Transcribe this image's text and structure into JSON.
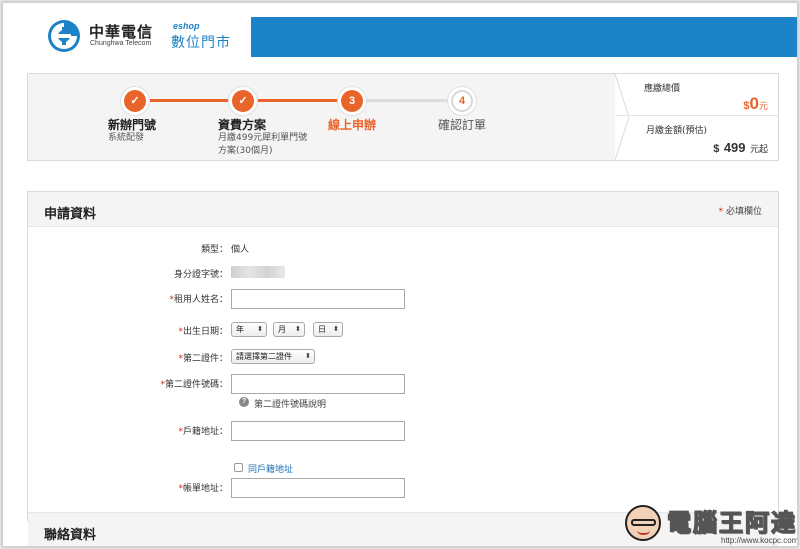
{
  "header": {
    "brand_cn": "中華電信",
    "brand_en": "Chunghwa Telecom",
    "eshop_tag": "eshop",
    "eshop_cn": "數位門市",
    "accent_color": "#1d83c8"
  },
  "steps": [
    {
      "num": "✓",
      "title": "新辦門號",
      "sub": "系統配發",
      "state": "done"
    },
    {
      "num": "✓",
      "title": "資費方案",
      "sub": "月繳499元犀利單門號方案(30個月)",
      "state": "done"
    },
    {
      "num": "3",
      "title": "線上申辦",
      "sub": "",
      "state": "current"
    },
    {
      "num": "4",
      "title": "確認訂單",
      "sub": "",
      "state": "todo"
    }
  ],
  "step2_sub_line1": "月繳499元犀利單門號",
  "step2_sub_line2": "方案(30個月)",
  "price": {
    "due_label": "應繳總價",
    "due_currency": "$",
    "due_value": "0",
    "due_unit": "元",
    "monthly_label": "月繳金額(預估)",
    "monthly_currency": "$",
    "monthly_value": "499",
    "monthly_unit": "元起",
    "accent_color": "#e9642b"
  },
  "form": {
    "title": "申請資料",
    "required_note": "必填欄位",
    "required_star": "*",
    "type_label": "類型：",
    "type_value": "個人",
    "id_label": "身分證字號：",
    "name_label": "租用人姓名：",
    "birth_label": "出生日期：",
    "birth_year": "年",
    "birth_month": "月",
    "birth_day": "日",
    "second_id_label": "第二證件：",
    "second_id_select": "請選擇第二證件",
    "second_id_no_label": "第二證件號碼：",
    "second_id_help": "第二證件號碼說明",
    "household_label": "戶籍地址：",
    "same_address": "同戶籍地址",
    "billing_label": "帳單地址："
  },
  "contact": {
    "title": "聯絡資料"
  },
  "watermark": {
    "text": "電腦王阿達",
    "url": "http://www.kocpc.com.tw"
  }
}
